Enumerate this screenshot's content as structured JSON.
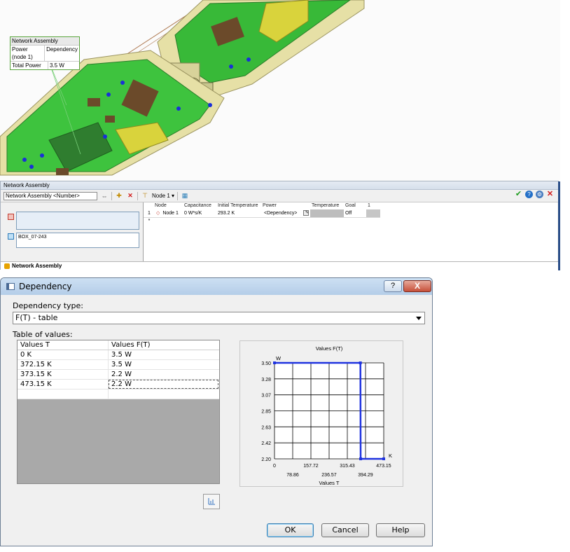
{
  "viewport": {
    "callout": {
      "title": "Network Assembly",
      "rows": [
        {
          "label": "Power (node 1)",
          "value": "Dependency"
        },
        {
          "label": "Total Power",
          "value": "3.5 W"
        }
      ]
    }
  },
  "panel": {
    "title": "Network Assembly",
    "toolbar": {
      "name_field": "Network Assembly <Number>",
      "node_dropdown": "Node 1"
    },
    "left_items": [
      {
        "label": ""
      },
      {
        "label": "BOX_07-243"
      }
    ],
    "grid": {
      "headers": [
        "",
        "Node",
        "Capacitance",
        "Initial Temperature",
        "Power",
        "Temperature",
        "Goal",
        "1"
      ],
      "row": {
        "index": "1",
        "node": "Node 1",
        "capacitance": "0 W*s/K",
        "initial_temp": "293.2 K",
        "power": "<Dependency>",
        "temperature": "",
        "goal": "Off"
      },
      "new_row_marker": "*"
    },
    "tab": "Network Assembly"
  },
  "dialog": {
    "title": "Dependency",
    "help_label": "?",
    "close_label": "X",
    "dependency_type_label": "Dependency type:",
    "dependency_type_value": "F(T) - table",
    "table_label": "Table of values:",
    "table": {
      "headers": [
        "Values T",
        "Values F(T)"
      ],
      "rows": [
        [
          "0 K",
          "3.5 W"
        ],
        [
          "372.15 K",
          "3.5 W"
        ],
        [
          "373.15 K",
          "2.2 W"
        ],
        [
          "473.15 K",
          "2.2 W"
        ]
      ]
    },
    "buttons": {
      "ok": "OK",
      "cancel": "Cancel",
      "help": "Help"
    }
  },
  "chart_data": {
    "type": "line",
    "title": "Values F(T)",
    "xlabel": "Values T",
    "ylabel": "",
    "x_unit": "K",
    "y_unit": "W",
    "x": [
      0,
      372.15,
      373.15,
      473.15
    ],
    "series": [
      {
        "values": [
          3.5,
          3.5,
          2.2,
          2.2
        ]
      }
    ],
    "xlim": [
      0,
      473.15
    ],
    "ylim": [
      2.2,
      3.5
    ],
    "x_ticks_upper": [
      "0",
      "157.72",
      "315.43",
      "473.15"
    ],
    "x_ticks_lower": [
      "78.86",
      "236.57",
      "394.29"
    ],
    "y_ticks": [
      "3.50",
      "3.28",
      "3.07",
      "2.85",
      "2.63",
      "2.42",
      "2.20"
    ],
    "grid": true,
    "color": "#1f33e0"
  }
}
